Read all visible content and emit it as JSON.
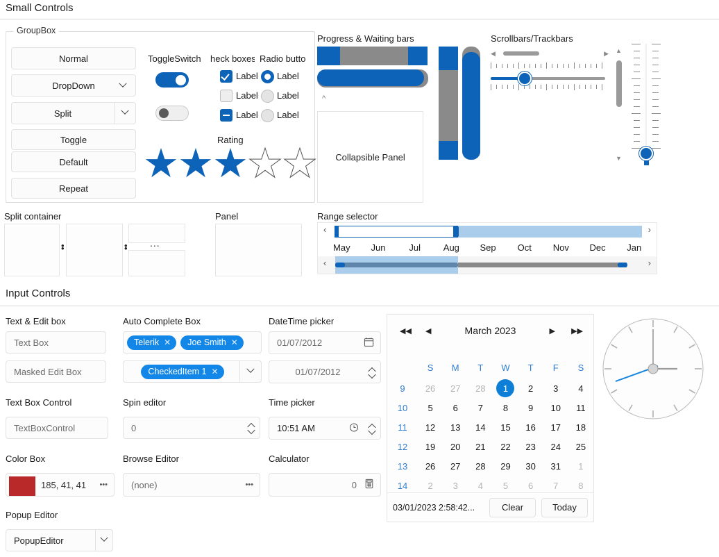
{
  "sections": {
    "small_controls": "Small Controls",
    "input_controls": "Input Controls"
  },
  "groupbox": {
    "title": "GroupBox",
    "buttons": [
      {
        "label": "Normal",
        "type": "normal"
      },
      {
        "label": "DropDown",
        "type": "dropdown"
      },
      {
        "label": "Split",
        "type": "split"
      },
      {
        "label": "Toggle",
        "type": "normal"
      },
      {
        "label": "Default",
        "type": "normal"
      },
      {
        "label": "Repeat",
        "type": "normal"
      }
    ]
  },
  "toggle_switch": {
    "label": "ToggleSwitch",
    "on_state": "on",
    "off_state": "off"
  },
  "check_boxes": {
    "label": "heck boxes",
    "full_label": "Check boxes",
    "items": [
      {
        "label": "Label",
        "state": "checked"
      },
      {
        "label": "Label",
        "state": "unchecked"
      },
      {
        "label": "Label",
        "state": "indeterminate"
      }
    ]
  },
  "radio_buttons": {
    "label": "Radio butto",
    "full_label": "Radio buttons",
    "items": [
      {
        "label": "Label",
        "state": "selected"
      },
      {
        "label": "Label",
        "state": "unselected"
      },
      {
        "label": "Label",
        "state": "unselected"
      }
    ]
  },
  "rating": {
    "label": "Rating",
    "value": 3,
    "max": 5
  },
  "progress": {
    "label": "Progress & Waiting bars",
    "collapsible_panel_label": "Collapsible Panel"
  },
  "scrollbars": {
    "label": "Scrollbars/Trackbars"
  },
  "split_container": {
    "label": "Split container",
    "dots": "..."
  },
  "panel": {
    "label": "Panel"
  },
  "range_selector": {
    "label": "Range selector",
    "months": [
      "May",
      "Jun",
      "Jul",
      "Aug",
      "Sep",
      "Oct",
      "Nov",
      "Dec",
      "Jan"
    ],
    "prev_arrow": "‹",
    "next_arrow": "›"
  },
  "inputs": {
    "text_edit_box": {
      "label": "Text & Edit box",
      "text_box_placeholder": "Text Box",
      "masked_edit_placeholder": "Masked Edit Box"
    },
    "text_box_control": {
      "label": "Text Box Control",
      "placeholder": "TextBoxControl"
    },
    "color_box": {
      "label": "Color Box",
      "value": "185, 41, 41",
      "color": "#b92929",
      "more": "•••"
    },
    "popup_editor": {
      "label": "Popup Editor",
      "value": "PopupEditor"
    },
    "auto_complete": {
      "label": "Auto Complete Box",
      "tokens": [
        "Telerik",
        "Joe Smith"
      ],
      "checked_token": "CheckedItem 1",
      "close_glyph": "✕"
    },
    "spin_editor": {
      "label": "Spin editor",
      "value": "0"
    },
    "browse_editor": {
      "label": "Browse Editor",
      "value": "(none)",
      "more": "•••"
    },
    "datetime_picker": {
      "label": "DateTime picker",
      "date_value": "01/07/2012",
      "date_value_2": "01/07/2012"
    },
    "time_picker": {
      "label": "Time picker",
      "value": "10:51 AM"
    },
    "calculator": {
      "label": "Calculator",
      "value": "0"
    }
  },
  "calendar": {
    "title": "March 2023",
    "nav": {
      "first": "◀◀",
      "prev": "◀",
      "next": "▶",
      "last": "▶▶"
    },
    "day_headers": [
      "S",
      "M",
      "T",
      "W",
      "T",
      "F",
      "S"
    ],
    "weeks": [
      {
        "num": "9",
        "days": [
          {
            "d": "26",
            "type": "out"
          },
          {
            "d": "27",
            "type": "out"
          },
          {
            "d": "28",
            "type": "out"
          },
          {
            "d": "1",
            "type": "selected"
          },
          {
            "d": "2",
            "type": "in"
          },
          {
            "d": "3",
            "type": "in"
          },
          {
            "d": "4",
            "type": "in"
          }
        ]
      },
      {
        "num": "10",
        "days": [
          {
            "d": "5",
            "type": "in"
          },
          {
            "d": "6",
            "type": "in"
          },
          {
            "d": "7",
            "type": "in"
          },
          {
            "d": "8",
            "type": "in"
          },
          {
            "d": "9",
            "type": "in"
          },
          {
            "d": "10",
            "type": "in"
          },
          {
            "d": "11",
            "type": "in"
          }
        ]
      },
      {
        "num": "11",
        "days": [
          {
            "d": "12",
            "type": "in"
          },
          {
            "d": "13",
            "type": "in"
          },
          {
            "d": "14",
            "type": "in"
          },
          {
            "d": "15",
            "type": "in"
          },
          {
            "d": "16",
            "type": "in"
          },
          {
            "d": "17",
            "type": "in"
          },
          {
            "d": "18",
            "type": "in"
          }
        ]
      },
      {
        "num": "12",
        "days": [
          {
            "d": "19",
            "type": "in"
          },
          {
            "d": "20",
            "type": "in"
          },
          {
            "d": "21",
            "type": "in"
          },
          {
            "d": "22",
            "type": "in"
          },
          {
            "d": "23",
            "type": "in"
          },
          {
            "d": "24",
            "type": "in"
          },
          {
            "d": "25",
            "type": "in"
          }
        ]
      },
      {
        "num": "13",
        "days": [
          {
            "d": "26",
            "type": "in"
          },
          {
            "d": "27",
            "type": "in"
          },
          {
            "d": "28",
            "type": "in"
          },
          {
            "d": "29",
            "type": "in"
          },
          {
            "d": "30",
            "type": "in"
          },
          {
            "d": "31",
            "type": "in"
          },
          {
            "d": "1",
            "type": "out"
          }
        ]
      },
      {
        "num": "14",
        "days": [
          {
            "d": "2",
            "type": "out"
          },
          {
            "d": "3",
            "type": "out"
          },
          {
            "d": "4",
            "type": "out"
          },
          {
            "d": "5",
            "type": "out"
          },
          {
            "d": "6",
            "type": "out"
          },
          {
            "d": "7",
            "type": "out"
          },
          {
            "d": "8",
            "type": "out"
          }
        ]
      }
    ],
    "footer_text": "03/01/2023 2:58:42...",
    "clear_label": "Clear",
    "today_label": "Today"
  },
  "clock": {
    "hour": 3,
    "minute": 0,
    "second": 41
  },
  "colors": {
    "accent": "#0d63b8",
    "accent_light": "#1287e8",
    "grey_track": "#8a8a8a",
    "range_light": "#aacdec",
    "border": "#e2e2e2"
  }
}
